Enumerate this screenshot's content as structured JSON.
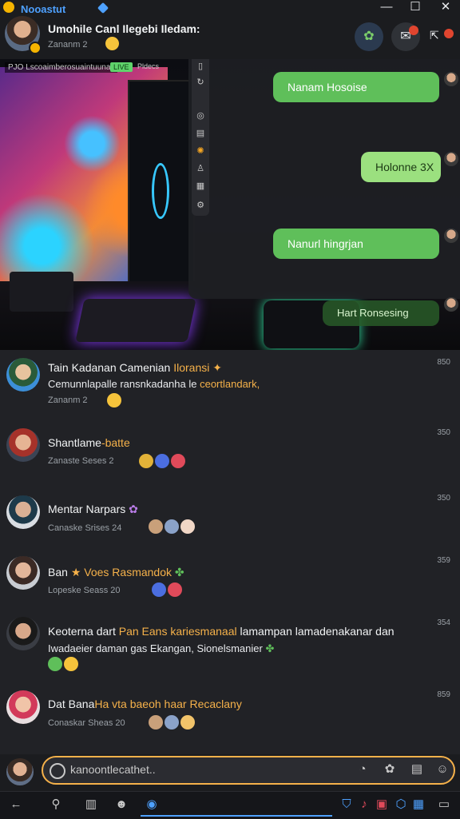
{
  "app": {
    "name": "Nooastut"
  },
  "window": {
    "minimize": "—",
    "maximize": "☐",
    "close": "✕"
  },
  "header": {
    "title": "Umohile Canl Ilegebi Iledam:",
    "subtitle": "Zananm 2",
    "actions": [
      {
        "icon": "leaf-icon",
        "glyph": "✿"
      },
      {
        "icon": "chat-icon",
        "glyph": "✉"
      },
      {
        "icon": "share-icon",
        "glyph": "⇱"
      }
    ]
  },
  "hero": {
    "overlay_label": "PJO Lscoaimberosuaintuunail",
    "overlay_badge": "LIVE",
    "overlay_tag": "Pldecs",
    "messages": [
      {
        "text": "Nanam Hosoise"
      },
      {
        "text": "Holonne 3X"
      },
      {
        "text": "Nanurl hingrjan"
      },
      {
        "text": "Hart Ronsesing"
      }
    ]
  },
  "feed": {
    "posts": [
      {
        "name": "Tain Kadanan Camenian",
        "name_hl": "Iloransi",
        "text": "Cemunnlapalle ransnkadanha le",
        "text_hl": "ceortlandark,",
        "meta": "Zananm 2",
        "time": "850"
      },
      {
        "name": "Shantlame",
        "name_hl": "-batte",
        "meta": "Zanaste Seses 2",
        "time": "350"
      },
      {
        "name": "Mentar Narpars",
        "name_hl": "",
        "meta": "Canaske Srises 24",
        "time": "350"
      },
      {
        "name": "Ban",
        "name_hl": "Voes Rasmandok",
        "meta": "Lopeske Seass 20",
        "time": "359"
      },
      {
        "name": "Keoterna dart",
        "name_hl": "Pan Eans kariesmanaal",
        "text": "lamampan lamadenakanar dan",
        "text2": "Iwadaeier daman gas Ekangan, Sionelsmanier",
        "meta": "",
        "time": "354"
      },
      {
        "name": "Dat Bana",
        "name_hl": "Ha vta baeoh haar Recaclany",
        "meta": "Conaskar Sheas 20",
        "time": "859"
      }
    ]
  },
  "composer": {
    "placeholder": "kanoontlecathet.."
  },
  "colors": {
    "accent": "#4ea1ff",
    "highlight": "#f5b14a",
    "bubble": "#5fbf5a",
    "background": "#202124"
  }
}
